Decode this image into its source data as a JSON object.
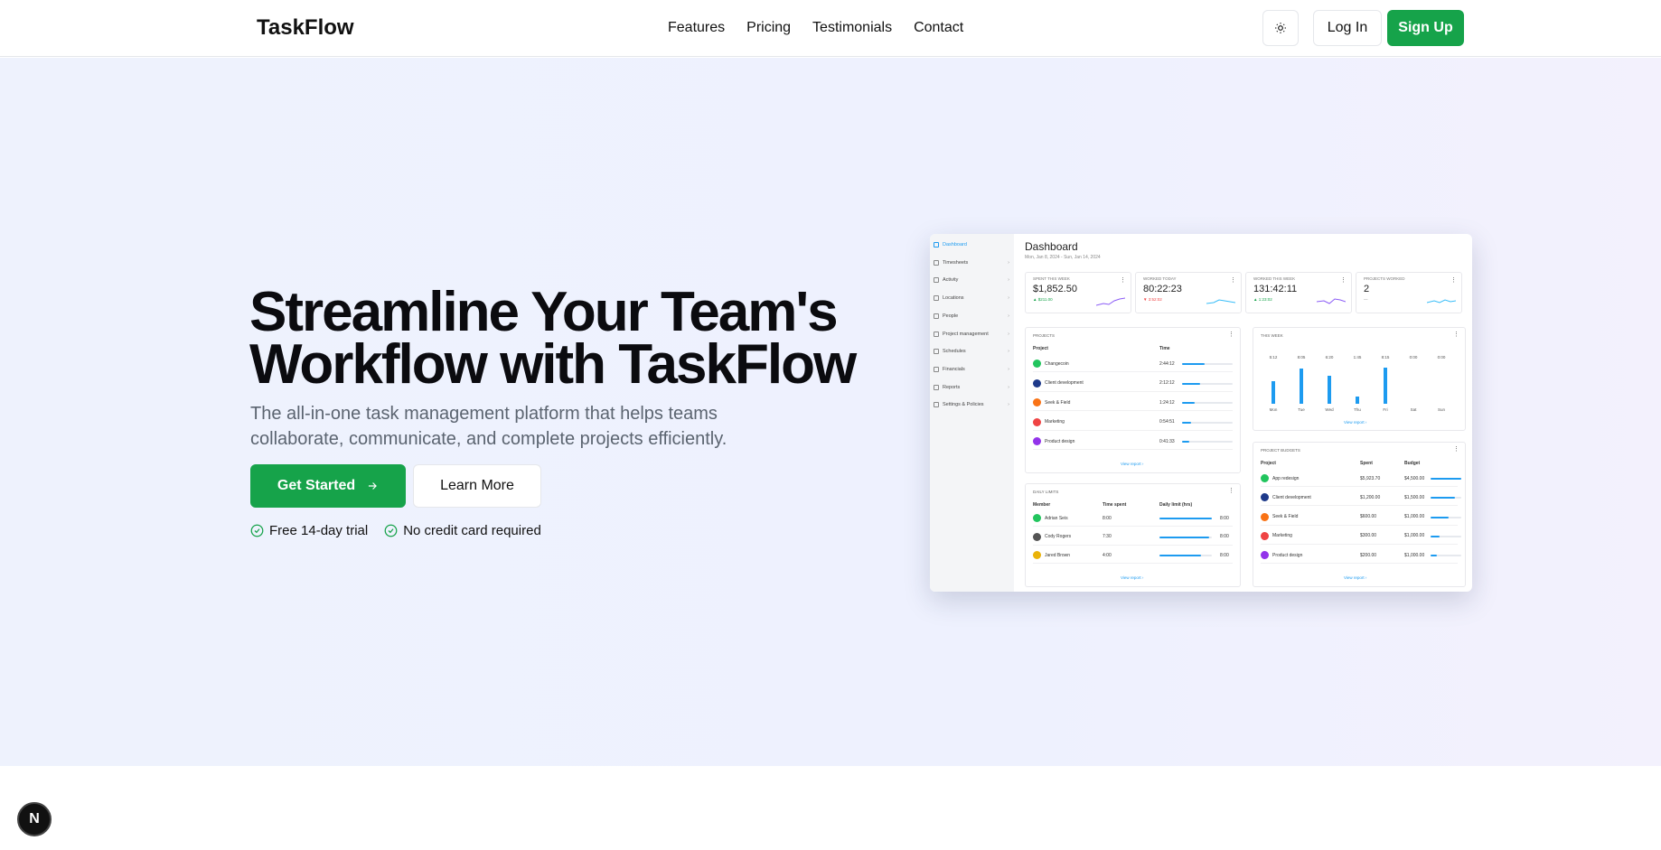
{
  "nav": {
    "brand": "TaskFlow",
    "links": [
      "Features",
      "Pricing",
      "Testimonials",
      "Contact"
    ],
    "theme_icon": "sun-icon",
    "login": "Log In",
    "signup": "Sign Up"
  },
  "hero": {
    "title_line1": "Streamline Your Team's",
    "title_line2": "Workflow with TaskFlow",
    "subtitle": "The all-in-one task management platform that helps teams collaborate, communicate, and complete projects efficiently.",
    "cta": "Get Started",
    "cta_icon": "arrow-right-icon",
    "secondary": "Learn More",
    "perks": [
      "Free 14-day trial",
      "No credit card required"
    ]
  },
  "badge": "N",
  "dashboard": {
    "sidebar": [
      "Dashboard",
      "Timesheets",
      "Activity",
      "Locations",
      "People",
      "Project management",
      "Schedules",
      "Financials",
      "Reports",
      "Settings & Policies"
    ],
    "title": "Dashboard",
    "date_range": "Mon, Jan 8, 2024 - Sun, Jan 14, 2024",
    "stats": [
      {
        "label": "Spent this week",
        "value": "$1,852.50",
        "delta": "▲ $211.00",
        "delta_color": "#16a34a"
      },
      {
        "label": "Worked today",
        "value": "80:22:23",
        "delta": "▼ 3:52:02",
        "delta_color": "#ef4444"
      },
      {
        "label": "Worked this week",
        "value": "131:42:11",
        "delta": "▲ 1:23:02",
        "delta_color": "#16a34a"
      },
      {
        "label": "Projects worked",
        "value": "2",
        "delta": "—",
        "delta_color": "#888"
      }
    ],
    "projects": {
      "title": "Projects",
      "headers": [
        "Project",
        "Time"
      ],
      "rows": [
        {
          "name": "Changecoin",
          "time": "2:44:12",
          "color": "#22c55e",
          "initial": "C",
          "level": 0.45
        },
        {
          "name": "Client development",
          "time": "2:12:12",
          "color": "#1e3a8a",
          "initial": "C",
          "level": 0.35
        },
        {
          "name": "Seek & Field",
          "time": "1:24:12",
          "color": "#f97316",
          "initial": "S",
          "level": 0.25
        },
        {
          "name": "Marketing",
          "time": "0:54:51",
          "color": "#ef4444",
          "initial": "M",
          "level": 0.18
        },
        {
          "name": "Product design",
          "time": "0:41:33",
          "color": "#9333ea",
          "initial": "P",
          "level": 0.14
        }
      ],
      "link": "View report ›"
    },
    "this_week": {
      "title": "This week",
      "labels": [
        "5:12",
        "8:05",
        "6:20",
        "1:45",
        "8:15",
        "0:00",
        "0:00"
      ],
      "days": [
        "Mon",
        "Tue",
        "Wed",
        "Thu",
        "Fri",
        "Sat",
        "Sun"
      ],
      "hours": [
        5.2,
        8.08,
        6.33,
        1.75,
        8.25,
        0,
        0
      ],
      "link": "View report ›"
    },
    "daily_limits": {
      "title": "Daily limits",
      "headers": [
        "Member",
        "Time spent",
        "Daily limit (hrs)"
      ],
      "rows": [
        {
          "name": "Adrian Seis",
          "spent": "8:00",
          "limit": "8:00",
          "color": "#22c55e",
          "level": 1.0
        },
        {
          "name": "Cody Rogers",
          "spent": "7:30",
          "limit": "8:00",
          "color": "#555",
          "level": 0.94
        },
        {
          "name": "Jared Brown",
          "spent": "4:00",
          "limit": "8:00",
          "color": "#eab308",
          "level": 0.8
        }
      ],
      "link": "View report ›"
    },
    "project_budgets": {
      "title": "Project budgets",
      "headers": [
        "Project",
        "Spent",
        "Budget"
      ],
      "rows": [
        {
          "name": "App redesign",
          "spent": "$5,923.70",
          "budget": "$4,500.00",
          "color": "#22c55e",
          "initial": "A",
          "level": 1.0
        },
        {
          "name": "Client development",
          "spent": "$1,200.00",
          "budget": "$1,500.00",
          "color": "#1e3a8a",
          "initial": "C",
          "level": 0.8
        },
        {
          "name": "Seek & Field",
          "spent": "$600.00",
          "budget": "$1,000.00",
          "color": "#f97316",
          "initial": "S",
          "level": 0.6
        },
        {
          "name": "Marketing",
          "spent": "$300.00",
          "budget": "$1,000.00",
          "color": "#ef4444",
          "initial": "M",
          "level": 0.3
        },
        {
          "name": "Product design",
          "spent": "$200.00",
          "budget": "$1,000.00",
          "color": "#9333ea",
          "initial": "P",
          "level": 0.2
        }
      ],
      "link": "View report ›"
    }
  }
}
